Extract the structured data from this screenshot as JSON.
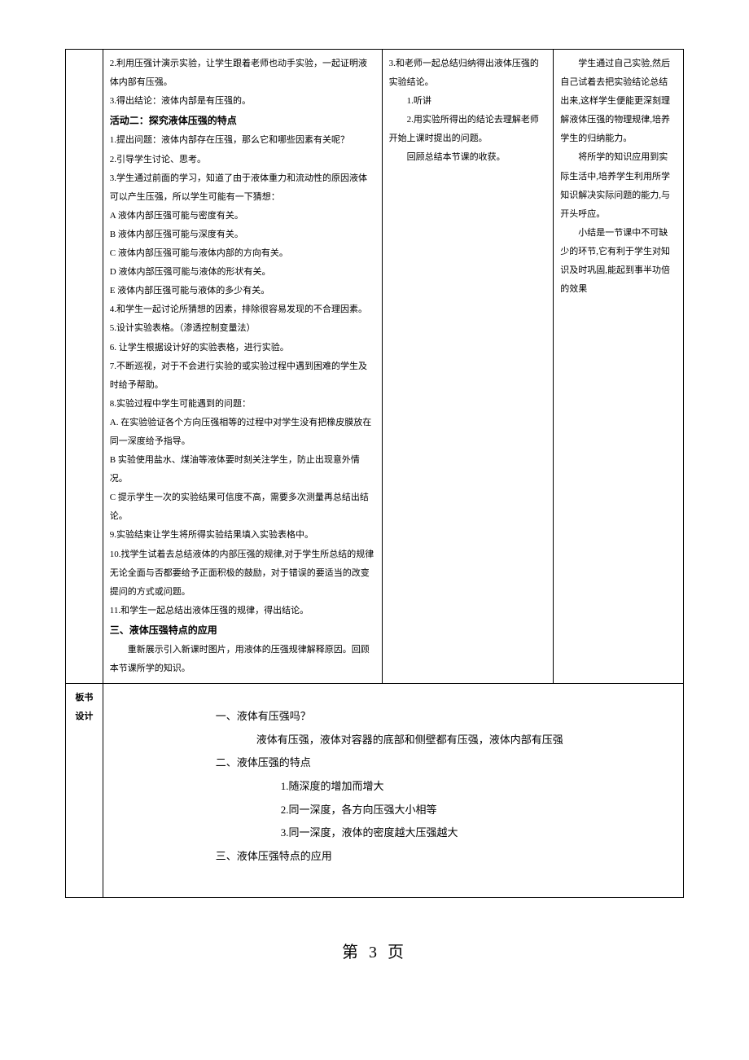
{
  "colA": {
    "l1": "2.利用压强计演示实验，让学生跟着老师也动手实验，一起证明液体内部有压强。",
    "l2": "3.得出结论：液体内部是有压强的。",
    "h1": "活动二：探究液体压强的特点",
    "l3": "1.提出问题：液体内部存在压强，那么它和哪些因素有关呢？",
    "l4": "2.引导学生讨论、思考。",
    "l5": "3.学生通过前面的学习，知道了由于液体重力和流动性的原因液体可以产生压强，所以学生可能有一下猜想：",
    "l6": "A 液体内部压强可能与密度有关。",
    "l7": "B 液体内部压强可能与深度有关。",
    "l8": "C 液体内部压强可能与液体内部的方向有关。",
    "l9": "D 液体内部压强可能与液体的形状有关。",
    "l10": "E 液体内部压强可能与液体的多少有关。",
    "l11": "4.和学生一起讨论所猜想的因素，排除很容易发现的不合理因素。",
    "l12": "5.设计实验表格。（渗透控制变量法）",
    "l13": "6.  让学生根据设计好的实验表格，进行实验。",
    "l14": "7.不断巡视，对于不会进行实验的或实验过程中遇到困难的学生及时给予帮助。",
    "l15": "8.实验过程中学生可能遇到的问题：",
    "l16": "A. 在实验验证各个方向压强相等的过程中对学生没有把橡皮膜放在同一深度给予指导。",
    "l17": "B 实验使用盐水、煤油等液体要时刻关注学生，防止出现意外情况。",
    "l18": "C 提示学生一次的实验结果可信度不高，需要多次测量再总结出结论。",
    "l19": "9.实验结束让学生将所得实验结果填入实验表格中。",
    "l20": "10.找学生试着去总结液体的内部压强的规律,对于学生所总结的规律无论全面与否都要给予正面积极的鼓励，对于错误的要适当的改变提问的方式或问题。",
    "l21": "11.和学生一起总结出液体压强的规律，得出结论。",
    "h2": "三、液体压强特点的应用",
    "l22": "重新展示引入新课时图片，用液体的压强规律解释原因。回顾本节课所学的知识。"
  },
  "colB": {
    "l1": "3.和老师一起总结归纳得出液体压强的实验结论。",
    "l2": "1.听讲",
    "l3": "2.用实验所得出的结论去理解老师开始上课时提出的问题。",
    "l4": "回顾总结本节课的收获。"
  },
  "colC": {
    "l1": "学生通过自己实验,然后自己试着去把实验结论总结出来,这样学生便能更深刻理解液体压强的物理规律,培养学生的归纳能力。",
    "l2": "将所学的知识应用到实际生活中,培养学生利用所学知识解决实际问题的能力,与开头呼应。",
    "l3": "小结是一节课中不可缺少的环节,它有利于学生对知识及时巩固,能起到事半功倍的效果"
  },
  "leftLabel": "板书设计",
  "board": {
    "t1": "一、液体有压强吗？",
    "t1a": "液体有压强，液体对容器的底部和侧壁都有压强，液体内部有压强",
    "t2": "二、液体压强的特点",
    "t2a": "1.随深度的增加而增大",
    "t2b": "2.同一深度，各方向压强大小相等",
    "t2c": "3.同一深度，液体的密度越大压强越大",
    "t3": "三、液体压强特点的应用"
  },
  "pageNumber": "第 3 页"
}
